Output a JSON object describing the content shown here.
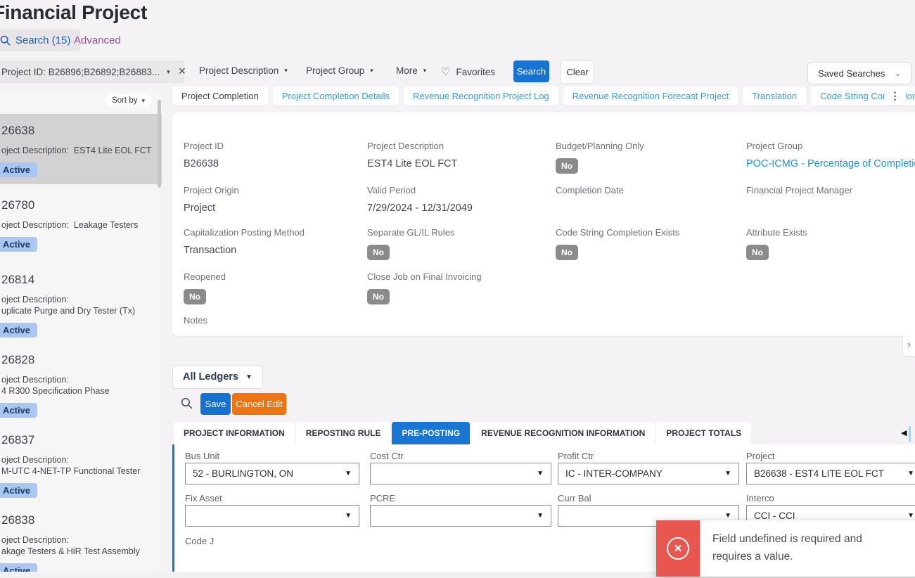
{
  "header": {
    "title": "Financial Project",
    "search_tab": "Search (15)",
    "advanced_tab": "Advanced"
  },
  "filter_bar": {
    "project_id_pill": "Project ID: B26896;B26892;B26883...",
    "project_description": "Project Description",
    "project_group": "Project Group",
    "more": "More",
    "favorites": "Favorites",
    "search_button": "Search",
    "clear_button": "Clear",
    "saved_searches": "Saved Searches"
  },
  "doc_tabs": {
    "tab1": "Project Completion",
    "tab2": "Project Completion Details",
    "tab3": "Revenue Recognition Project Log",
    "tab4": "Revenue Recognition Forecast Project",
    "tab5": "Translation",
    "tab6": "Code String Completion"
  },
  "sidebar": {
    "sort_by": "Sort by",
    "items": [
      {
        "id": "26638",
        "desc1": "oject Description:  EST4 Lite EOL FCT",
        "desc2": "",
        "status": "Active"
      },
      {
        "id": "26780",
        "desc1": "oject Description:  Leakage Testers",
        "desc2": "",
        "status": "Active"
      },
      {
        "id": "26814",
        "desc1": "oject Description:",
        "desc2": "uplicate Purge and Dry Tester (Tx)",
        "status": "Active"
      },
      {
        "id": "26828",
        "desc1": "oject Description:",
        "desc2": "4 R300 Specification Phase",
        "status": "Active"
      },
      {
        "id": "26837",
        "desc1": "oject Description:",
        "desc2": "M-UTC 4-NET-TP Functional Tester",
        "status": "Active"
      },
      {
        "id": "26838",
        "desc1": "oject Description:",
        "desc2": "akage Testers & HiR Test Assembly",
        "status": "Active"
      }
    ]
  },
  "details": {
    "project_id": {
      "label": "Project ID",
      "value": "B26638"
    },
    "project_description": {
      "label": "Project Description",
      "value": "EST4 Lite EOL FCT"
    },
    "budget_planning_only": {
      "label": "Budget/Planning Only",
      "value": "No"
    },
    "project_group": {
      "label": "Project Group",
      "value": "POC-ICMG - Percentage of Completion IC D"
    },
    "project_origin": {
      "label": "Project Origin",
      "value": "Project"
    },
    "valid_period": {
      "label": "Valid Period",
      "value": "7/29/2024 - 12/31/2049"
    },
    "completion_date": {
      "label": "Completion Date",
      "value": ""
    },
    "financial_project_manager": {
      "label": "Financial Project Manager",
      "value": ""
    },
    "capitalization_posting_method": {
      "label": "Capitalization Posting Method",
      "value": "Transaction"
    },
    "separate_gl_il_rules": {
      "label": "Separate GL/IL Rules",
      "value": "No"
    },
    "code_string_completion_exists": {
      "label": "Code String Completion Exists",
      "value": "No"
    },
    "attribute_exists": {
      "label": "Attribute Exists",
      "value": "No"
    },
    "reopened": {
      "label": "Reopened",
      "value": "No"
    },
    "close_job_on_final_invoicing": {
      "label": "Close Job on Final Invoicing",
      "value": "No"
    },
    "notes": {
      "label": "Notes"
    }
  },
  "ledger_bar": {
    "all_ledgers": "All Ledgers",
    "save_button": "Save",
    "cancel_edit_button": "Cancel Edit"
  },
  "sub_tabs": {
    "tab1": "PROJECT INFORMATION",
    "tab2": "REPOSTING RULE",
    "tab3": "PRE-POSTING",
    "tab4": "REVENUE RECOGNITION INFORMATION",
    "tab5": "PROJECT TOTALS"
  },
  "form": {
    "bus_unit": {
      "label": "Bus Unit",
      "value": "52 - BURLINGTON, ON"
    },
    "cost_ctr": {
      "label": "Cost Ctr",
      "value": ""
    },
    "profit_ctr": {
      "label": "Profit Ctr",
      "value": "IC - INTER-COMPANY"
    },
    "project": {
      "label": "Project",
      "value": "B26638 - EST4 LITE EOL FCT"
    },
    "fix_asset": {
      "label": "Fix Asset",
      "value": ""
    },
    "pcre": {
      "label": "PCRE",
      "value": ""
    },
    "curr_bal": {
      "label": "Curr Bal",
      "value": ""
    },
    "interco": {
      "label": "Interco",
      "value": "CCI - CCI"
    },
    "code_j": {
      "label": "Code J"
    }
  },
  "toast": {
    "message": "Field undefined is required and requires a value."
  },
  "colors": {
    "accent_blue": "#1976d2",
    "link_blue": "#2095d5",
    "doc_tab_blue": "#3b9bcd",
    "orange": "#ee7511",
    "toast_red": "#e8574f",
    "badge_gray": "#8b8b8b",
    "active_badge_bg": "#a9c7f0",
    "active_badge_text": "#1d3a66",
    "advanced_purple": "#9a4f9e"
  }
}
